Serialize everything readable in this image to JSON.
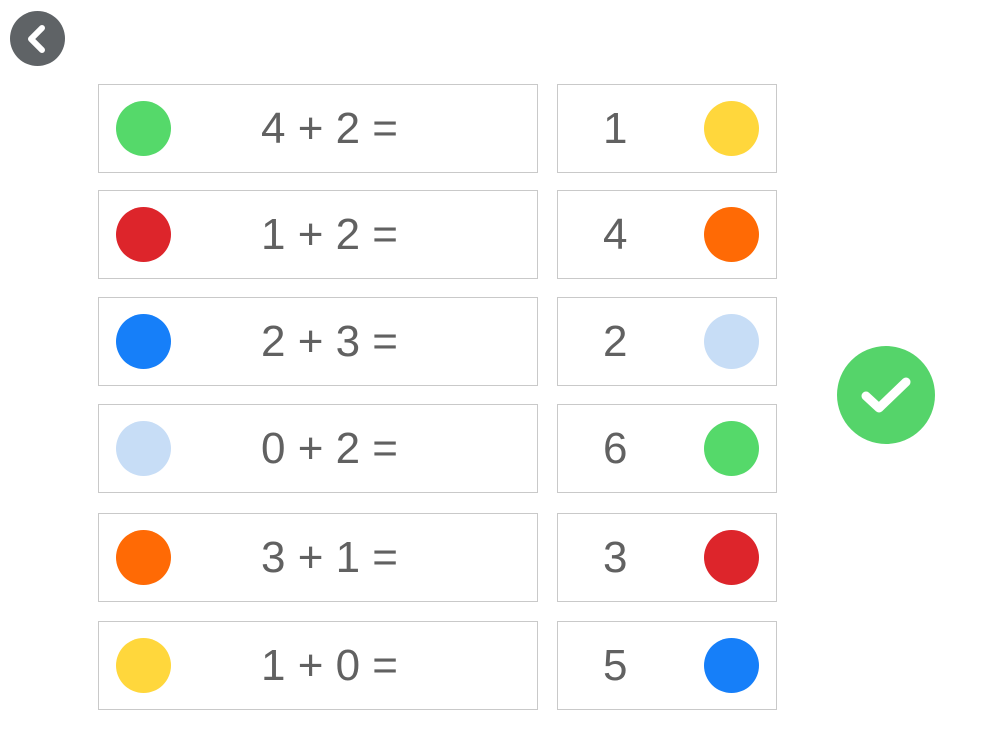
{
  "nav": {
    "back_icon": "chevron-left-icon"
  },
  "submit": {
    "icon": "checkmark-icon",
    "color": "#55d46a"
  },
  "equations": [
    {
      "text": "4 + 2 =",
      "color": "#55d96a"
    },
    {
      "text": "1 + 2 =",
      "color": "#dd252b"
    },
    {
      "text": "2 + 3 =",
      "color": "#167ff9"
    },
    {
      "text": "0 + 2 =",
      "color": "#c7ddf6"
    },
    {
      "text": "3 + 1 =",
      "color": "#ff6a05"
    },
    {
      "text": "1 + 0 =",
      "color": "#ffd73c"
    }
  ],
  "answers": [
    {
      "text": "1",
      "color": "#ffd73c"
    },
    {
      "text": "4",
      "color": "#ff6a05"
    },
    {
      "text": "2",
      "color": "#c7ddf6"
    },
    {
      "text": "6",
      "color": "#55d96a"
    },
    {
      "text": "3",
      "color": "#dd252b"
    },
    {
      "text": "5",
      "color": "#167ff9"
    }
  ]
}
